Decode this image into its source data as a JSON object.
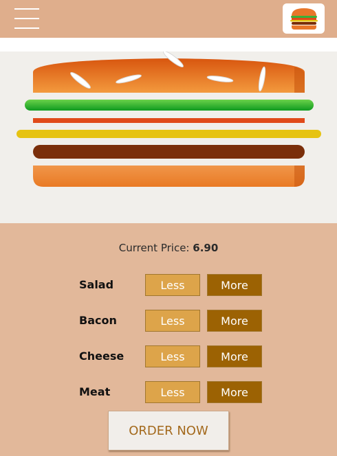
{
  "header": {
    "menu_icon": "hamburger-menu-icon",
    "logo_icon": "burger-logo-icon"
  },
  "price": {
    "label": "Current Price:",
    "value": "6.90"
  },
  "ingredients": [
    {
      "label": "Salad",
      "less": "Less",
      "more": "More"
    },
    {
      "label": "Bacon",
      "less": "Less",
      "more": "More"
    },
    {
      "label": "Cheese",
      "less": "Less",
      "more": "More"
    },
    {
      "label": "Meat",
      "less": "Less",
      "more": "More"
    }
  ],
  "order_button": "ORDER NOW",
  "colors": {
    "header_bg": "#dfae8c",
    "page_bg": "#e2b89a",
    "less_button": "#dda44a",
    "more_button": "#9c6203",
    "bun": "#e8762a",
    "salad": "#2fb432",
    "bacon": "#e04a1a",
    "cheese": "#e6c312",
    "meat": "#7a2e0a"
  }
}
